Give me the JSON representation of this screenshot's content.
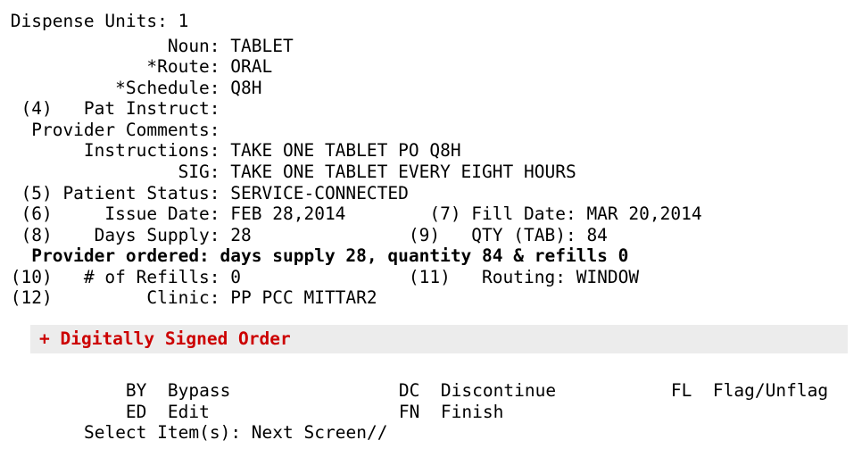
{
  "terminal": {
    "lines": [
      " Dispense Units: 1",
      "                Noun: TABLET",
      "              *Route: ORAL",
      "           *Schedule: Q8H",
      "  (4)   Pat Instruct:",
      "   Provider Comments:",
      "        Instructions: TAKE ONE TABLET PO Q8H",
      "                 SIG: TAKE ONE TABLET EVERY EIGHT HOURS",
      "  (5) Patient Status: SERVICE-CONNECTED",
      "  (6)     Issue Date: FEB 28,2014        (7) Fill Date: MAR 20,2014",
      "  (8)    Days Supply: 28               (9)   QTY (TAB): 84",
      "   Provider ordered: days supply 28, quantity 84 & refills 0",
      " (10)   # of Refills: 0                (11)   Routing: WINDOW",
      " (12)         Clinic: PP PCC MITTAR2"
    ]
  },
  "banner": {
    "text": "+ Digitally Signed Order",
    "color": "#cc0000"
  },
  "actions": [
    {
      "code": "BY",
      "label": "Bypass"
    },
    {
      "code": "DC",
      "label": "Discontinue"
    },
    {
      "code": "FL",
      "label": "Flag/Unflag"
    },
    {
      "code": "ED",
      "label": "Edit"
    },
    {
      "code": "FN",
      "label": "Finish"
    }
  ],
  "prompt": {
    "label": "Select Item(s): Next Screen//"
  }
}
